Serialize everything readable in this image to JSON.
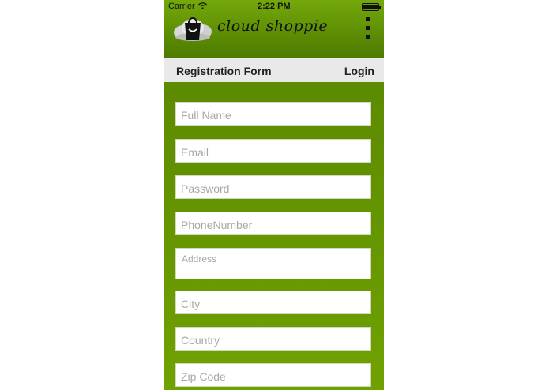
{
  "status_bar": {
    "carrier": "Carrier",
    "time": "2:22 PM",
    "battery_level": 1.0
  },
  "header": {
    "brand": "cloud shoppie",
    "logo_icon": "shopping-bag-cloud-icon",
    "menu_icon": "more-vertical-icon"
  },
  "tabs": {
    "registration": "Registration Form",
    "login": "Login"
  },
  "form": {
    "full_name": "Full Name",
    "email": "Email",
    "password": "Password",
    "phone": "PhoneNumber",
    "address": "Address",
    "city": "City",
    "country": "Country",
    "zip": "Zip Code"
  },
  "colors": {
    "header_green": "#74a80a",
    "form_green": "#5c8a00",
    "tab_bg": "#e9e9e9"
  }
}
